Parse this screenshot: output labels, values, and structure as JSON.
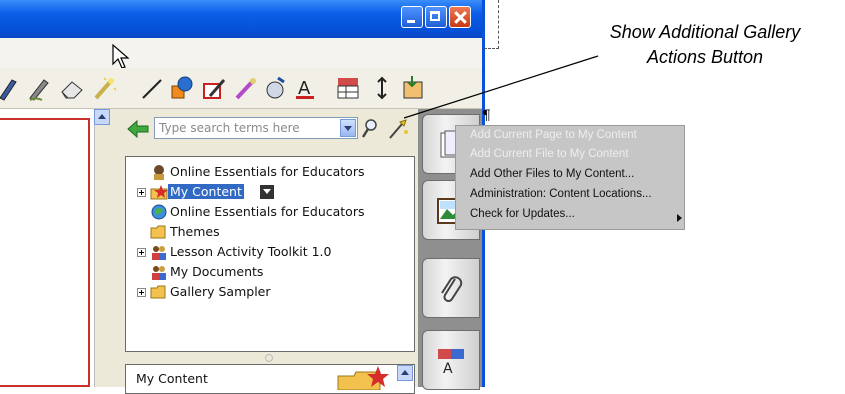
{
  "window": {
    "buttons": [
      "minimize",
      "maximize",
      "close"
    ]
  },
  "toolbar": {
    "tools": [
      "pens-icon",
      "creative-pen-icon",
      "eraser-icon",
      "magic-pen-icon",
      "line-icon",
      "shapes-icon",
      "fill-icon",
      "highlighter-pen-icon",
      "properties-icon",
      "text-icon",
      "table-icon",
      "move-icon",
      "extras-icon"
    ]
  },
  "gallery": {
    "search_placeholder": "Type search terms here",
    "tree": [
      {
        "label": "Online Essentials for Educators",
        "expander": false,
        "icon": "online-resources-icon"
      },
      {
        "label": "My Content",
        "expander": true,
        "icon": "my-content-icon",
        "selected": true
      },
      {
        "label": "Online Essentials for Educators",
        "expander": false,
        "icon": "globe-icon"
      },
      {
        "label": "Themes",
        "expander": false,
        "icon": "folder-icon"
      },
      {
        "label": "Lesson Activity Toolkit 1.0",
        "expander": true,
        "icon": "people-icon"
      },
      {
        "label": "My Documents",
        "expander": false,
        "icon": "people-icon"
      },
      {
        "label": "Gallery Sampler",
        "expander": true,
        "icon": "folder-icon"
      }
    ],
    "bottom_pane_title": "My Content"
  },
  "context_menu": {
    "items": [
      {
        "label": "Add Current Page to My Content",
        "enabled": false
      },
      {
        "label": "Add Current File to My Content",
        "enabled": false
      },
      {
        "label": "Add Other Files to My Content...",
        "enabled": true
      },
      {
        "label": "Administration: Content Locations...",
        "enabled": true
      },
      {
        "label": "Check for Updates...",
        "enabled": true,
        "submenu": true
      }
    ]
  },
  "callout": {
    "line1": "Show Additional Gallery",
    "line2": "Actions Button"
  },
  "side_tabs": [
    "page-sorter-icon",
    "gallery-icon",
    "attachments-icon",
    "properties-tab-icon"
  ],
  "colors": {
    "title_bar": "#0b5ee8",
    "selection": "#316ac5",
    "menu_background": "#c6c6c6",
    "page_border": "#c9302c"
  }
}
